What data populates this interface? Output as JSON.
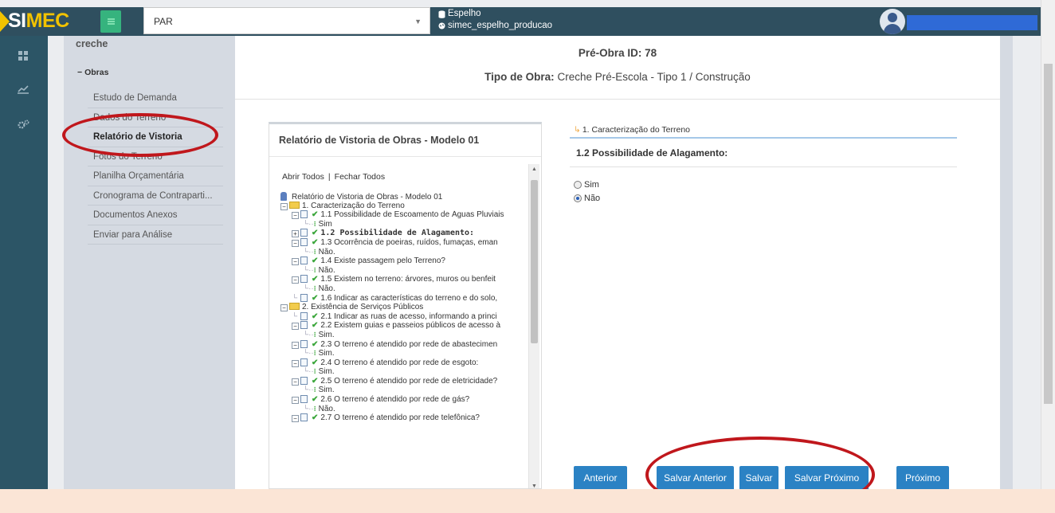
{
  "brand": {
    "part1": "SI",
    "part2": "MEC"
  },
  "system_select": {
    "value": "PAR"
  },
  "environment": {
    "line1": "Espelho",
    "line2": "simec_espelho_producao"
  },
  "sidemenu": {
    "title": "creche",
    "group": "Obras",
    "items": [
      {
        "label": "Estudo de Demanda"
      },
      {
        "label": "Dados do Terreno"
      },
      {
        "label": "Relatório de Vistoria"
      },
      {
        "label": "Fotos do Terreno"
      },
      {
        "label": "Planilha Orçamentária"
      },
      {
        "label": "Cronograma de Contraparti..."
      },
      {
        "label": "Documentos Anexos"
      },
      {
        "label": "Enviar para Análise"
      }
    ]
  },
  "header": {
    "preobra": "Pré-Obra ID: 78",
    "tipo_label": "Tipo de Obra:",
    "tipo_value": "Creche Pré-Escola - Tipo 1 / Construção"
  },
  "tree": {
    "title": "Relatório de Vistoria de Obras - Modelo 01",
    "open_all": "Abrir Todos",
    "separator": "|",
    "close_all": "Fechar Todos",
    "nodes": [
      {
        "kind": "root",
        "indent": 0,
        "label": "Relatório de Vistoria de Obras - Modelo 01"
      },
      {
        "kind": "folder",
        "indent": 0,
        "label": "1. Caracterização do Terreno"
      },
      {
        "kind": "question",
        "indent": 1,
        "label": "1.1 Possibilidade de Escoamento de Águas Pluviais"
      },
      {
        "kind": "answer",
        "indent": 2,
        "label": "Sim"
      },
      {
        "kind": "question",
        "indent": 1,
        "label": "1.2 Possibilidade de Alagamento:",
        "bold": true,
        "collapsed": true
      },
      {
        "kind": "question",
        "indent": 1,
        "label": "1.3 Ocorrência de poeiras, ruídos, fumaças, eman"
      },
      {
        "kind": "answer",
        "indent": 2,
        "label": "Não."
      },
      {
        "kind": "question",
        "indent": 1,
        "label": "1.4 Existe passagem pelo Terreno?"
      },
      {
        "kind": "answer",
        "indent": 2,
        "label": "Não."
      },
      {
        "kind": "question",
        "indent": 1,
        "label": "1.5 Existem no terreno: árvores, muros ou benfeit"
      },
      {
        "kind": "answer",
        "indent": 2,
        "label": "Não."
      },
      {
        "kind": "question-leaf",
        "indent": 1,
        "label": "1.6 Indicar as características do terreno e do solo,"
      },
      {
        "kind": "folder",
        "indent": 0,
        "label": "2. Existência de Serviços Públicos"
      },
      {
        "kind": "question-leaf",
        "indent": 1,
        "label": "2.1 Indicar as ruas de acesso, informando a princi"
      },
      {
        "kind": "question",
        "indent": 1,
        "label": "2.2 Existem guias e passeios públicos de acesso à"
      },
      {
        "kind": "answer",
        "indent": 2,
        "label": "Sim."
      },
      {
        "kind": "question",
        "indent": 1,
        "label": "2.3 O terreno é atendido por rede de abastecimen"
      },
      {
        "kind": "answer",
        "indent": 2,
        "label": "Sim."
      },
      {
        "kind": "question",
        "indent": 1,
        "label": "2.4 O terreno é atendido por rede de esgoto:"
      },
      {
        "kind": "answer",
        "indent": 2,
        "label": "Sim."
      },
      {
        "kind": "question",
        "indent": 1,
        "label": "2.5 O terreno é atendido por rede de eletricidade?"
      },
      {
        "kind": "answer",
        "indent": 2,
        "label": "Sim."
      },
      {
        "kind": "question",
        "indent": 1,
        "label": "2.6 O terreno é atendido por rede de gás?"
      },
      {
        "kind": "answer",
        "indent": 2,
        "label": "Não."
      },
      {
        "kind": "question",
        "indent": 1,
        "label": "2.7 O terreno é atendido por rede telefônica?"
      }
    ]
  },
  "form": {
    "breadcrumb": "1. Caracterização do Terreno",
    "question": "1.2 Possibilidade de Alagamento:",
    "options": [
      {
        "label": "Sim",
        "selected": false
      },
      {
        "label": "Não",
        "selected": true
      }
    ]
  },
  "buttons": {
    "anterior": "Anterior",
    "salvar_anterior": "Salvar Anterior",
    "salvar": "Salvar",
    "salvar_proximo": "Salvar Próximo",
    "proximo": "Próximo"
  },
  "colors": {
    "topbar": "#2f4f5f",
    "accent_button": "#2b82c4",
    "annotation": "#c0171c"
  }
}
